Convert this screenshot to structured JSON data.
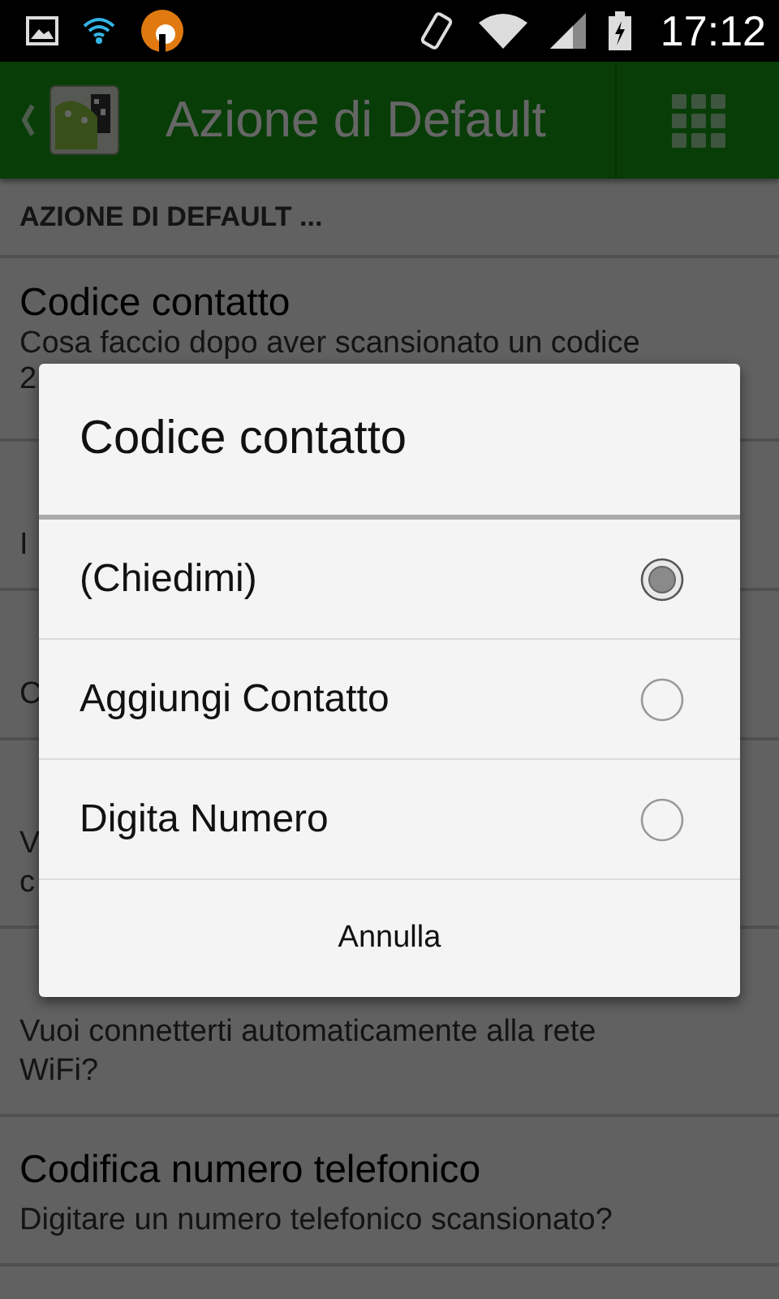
{
  "status_bar": {
    "time": "17:12"
  },
  "app_bar": {
    "title": "Azione di Default"
  },
  "section_header": "AZIONE DI DEFAULT ...",
  "settings": [
    {
      "title": "Codice contatto",
      "subtitle_lines": [
        "Cosa faccio dopo aver scansionato un codice",
        "2"
      ]
    },
    {
      "subtitle_lines": [
        "I"
      ]
    },
    {
      "subtitle_lines": [
        "C"
      ]
    },
    {
      "subtitle_lines": [
        "V",
        "c"
      ]
    },
    {
      "subtitle_lines": [
        "Vuoi connetterti automaticamente alla rete",
        "WiFi?"
      ]
    },
    {
      "title": "Codifica numero telefonico",
      "subtitle_lines": [
        "Digitare un numero telefonico scansionato?"
      ]
    }
  ],
  "dialog": {
    "title": "Codice contatto",
    "options": [
      {
        "label": "(Chiedimi)",
        "selected": true
      },
      {
        "label": "Aggiungi Contatto",
        "selected": false
      },
      {
        "label": "Digita Numero",
        "selected": false
      }
    ],
    "cancel": "Annulla"
  }
}
